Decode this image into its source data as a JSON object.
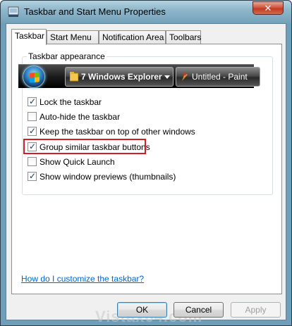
{
  "window": {
    "title": "Taskbar and Start Menu Properties",
    "close_glyph": "✕"
  },
  "tabs": [
    {
      "label": "Taskbar",
      "active": true
    },
    {
      "label": "Start Menu",
      "active": false
    },
    {
      "label": "Notification Area",
      "active": false
    },
    {
      "label": "Toolbars",
      "active": false
    }
  ],
  "group": {
    "label": "Taskbar appearance"
  },
  "taskbar_preview": {
    "buttons": [
      {
        "label": "7 Windows Explorer",
        "icon": "folder-icon"
      },
      {
        "label": "Untitled - Paint",
        "icon": "paint-icon"
      }
    ]
  },
  "options": [
    {
      "label": "Lock the taskbar",
      "checked": true
    },
    {
      "label": "Auto-hide the taskbar",
      "checked": false
    },
    {
      "label": "Keep the taskbar on top of other windows",
      "checked": true
    },
    {
      "label": "Group similar taskbar buttons",
      "checked": true
    },
    {
      "label": "Show Quick Launch",
      "checked": false
    },
    {
      "label": "Show window previews (thumbnails)",
      "checked": true
    }
  ],
  "help_link": "How do I customize the taskbar?",
  "watermark": "Vistax64.com",
  "buttons": {
    "ok": "OK",
    "cancel": "Cancel",
    "apply": "Apply"
  },
  "colors": {
    "highlight": "#d31c24",
    "link": "#0066cc"
  }
}
